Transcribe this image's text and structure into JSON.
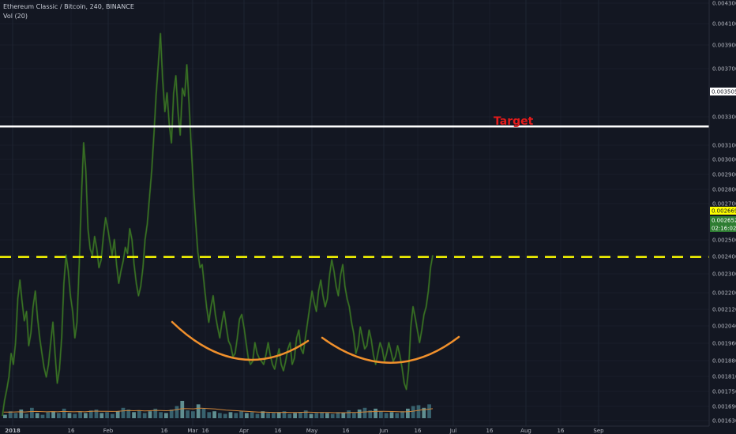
{
  "header": {
    "symbol": "Ethereum Classic / Bitcoin, 240, BINANCE",
    "volume_label": "Vol (20)"
  },
  "colors": {
    "background": "#131722",
    "grid": "#1e2433",
    "price_line": "#2f5a1f",
    "volume_bar": "#3f6f7a",
    "volume_bar_up": "#6ea4a4",
    "volume_ma": "#d0863a",
    "target_line": "#ffffff",
    "breakout_line": "#ffff00",
    "cup_arc": "#f0902c",
    "target_text": "#e31b1b"
  },
  "chart_data": {
    "type": "line",
    "price_axis": {
      "range": [
        0.0016,
        0.0043
      ],
      "tick_labels": [
        "0.004300",
        "0.004100",
        "0.003900",
        "0.003700",
        "0.003505",
        "0.003300",
        "0.003100",
        "0.003000",
        "0.002900",
        "0.002800",
        "0.002700",
        "0.002669",
        "0.002652",
        "02:16:02",
        "0.002500",
        "0.002400",
        "0.002300",
        "0.002200",
        "0.002120",
        "0.002040",
        "0.001960",
        "0.001880",
        "0.001810",
        "0.001750",
        "0.001690",
        "0.001630"
      ]
    },
    "time_axis": {
      "labels": [
        "2018",
        "16",
        "Feb",
        "16",
        "Mar",
        "16",
        "Apr",
        "16",
        "May",
        "16",
        "Jun",
        "16",
        "Jul",
        "16",
        "Aug",
        "16",
        "Sep"
      ]
    },
    "series": [
      {
        "values": [
          0.00165,
          0.00175,
          0.00182,
          0.0019,
          0.00205,
          0.00198,
          0.00212,
          0.0024,
          0.00252,
          0.00238,
          0.00226,
          0.00232,
          0.0021,
          0.00218,
          0.00235,
          0.00245,
          0.00228,
          0.00215,
          0.00205,
          0.00196,
          0.0019,
          0.00198,
          0.00212,
          0.00225,
          0.00205,
          0.00186,
          0.00195,
          0.00215,
          0.0025,
          0.00268,
          0.00258,
          0.00242,
          0.00232,
          0.00215,
          0.00225,
          0.00262,
          0.00305,
          0.0034,
          0.00322,
          0.00285,
          0.00272,
          0.00268,
          0.0028,
          0.00272,
          0.0026,
          0.00265,
          0.0028,
          0.00292,
          0.00285,
          0.00276,
          0.00268,
          0.00278,
          0.00262,
          0.0025,
          0.00258,
          0.00264,
          0.00273,
          0.00269,
          0.00285,
          0.00278,
          0.00262,
          0.0025,
          0.00242,
          0.00248,
          0.0026,
          0.00278,
          0.00288,
          0.00305,
          0.00322,
          0.00345,
          0.0037,
          0.0039,
          0.0041,
          0.0038,
          0.0036,
          0.00372,
          0.00352,
          0.0034,
          0.00372,
          0.00383,
          0.0036,
          0.00345,
          0.00375,
          0.0037,
          0.0039,
          0.00365,
          0.00338,
          0.00312,
          0.0029,
          0.0027,
          0.0026,
          0.00262,
          0.00248,
          0.00235,
          0.00225,
          0.00235,
          0.00242,
          0.0023,
          0.00222,
          0.00215,
          0.00225,
          0.00232,
          0.00222,
          0.00213,
          0.0021,
          0.00203,
          0.00205,
          0.00215,
          0.00227,
          0.0023,
          0.00222,
          0.00212,
          0.00202,
          0.00198,
          0.002,
          0.00212,
          0.00205,
          0.00202,
          0.002,
          0.00198,
          0.00204,
          0.00212,
          0.00204,
          0.00198,
          0.00195,
          0.00202,
          0.00208,
          0.00198,
          0.00194,
          0.002,
          0.00208,
          0.00212,
          0.00198,
          0.00202,
          0.00215,
          0.0022,
          0.00208,
          0.00205,
          0.00215,
          0.00225,
          0.00235,
          0.00245,
          0.00238,
          0.00232,
          0.00245,
          0.00252,
          0.00242,
          0.00235,
          0.0024,
          0.00255,
          0.00265,
          0.00258,
          0.00248,
          0.00242,
          0.00255,
          0.00262,
          0.00248,
          0.0024,
          0.00235,
          0.00225,
          0.00218,
          0.00205,
          0.0021,
          0.00222,
          0.00215,
          0.00208,
          0.0021,
          0.0022,
          0.00214,
          0.00204,
          0.00198,
          0.00205,
          0.00212,
          0.00208,
          0.002,
          0.00205,
          0.00212,
          0.00206,
          0.002,
          0.00203,
          0.0021,
          0.00204,
          0.00196,
          0.00186,
          0.00182,
          0.00195,
          0.00222,
          0.00235,
          0.00228,
          0.0022,
          0.00212,
          0.0022,
          0.0023,
          0.00235,
          0.00245,
          0.0026,
          0.00268
        ]
      }
    ],
    "annotations": {
      "target_text": "Target",
      "target_level": 0.003505,
      "breakout_level": 0.002669,
      "cup_1": {
        "from": "Mar 12",
        "to": "May 4",
        "depth_price": 0.00184
      },
      "cup_2": {
        "from": "May 5",
        "to": "Jun 28",
        "depth_price": 0.00184
      }
    },
    "volume": {
      "values": [
        0.2,
        0.4,
        0.3,
        0.5,
        0.25,
        0.6,
        0.3,
        0.2,
        0.35,
        0.4,
        0.3,
        0.55,
        0.3,
        0.25,
        0.4,
        0.3,
        0.45,
        0.5,
        0.3,
        0.35,
        0.25,
        0.4,
        0.6,
        0.5,
        0.35,
        0.45,
        0.3,
        0.4,
        0.55,
        0.35,
        0.3,
        0.5,
        0.7,
        1.0,
        0.45,
        0.4,
        0.8,
        0.55,
        0.35,
        0.4,
        0.3,
        0.25,
        0.35,
        0.3,
        0.4,
        0.3,
        0.35,
        0.25,
        0.4,
        0.3,
        0.3,
        0.35,
        0.4,
        0.25,
        0.3,
        0.35,
        0.45,
        0.25,
        0.3,
        0.35,
        0.3,
        0.25,
        0.35,
        0.3,
        0.45,
        0.3,
        0.5,
        0.6,
        0.45,
        0.55,
        0.4,
        0.3,
        0.35,
        0.3,
        0.4,
        0.55,
        0.7,
        0.75,
        0.6,
        0.8
      ],
      "ma_values": [
        0.35,
        0.35,
        0.36,
        0.37,
        0.36,
        0.38,
        0.39,
        0.38,
        0.37,
        0.38,
        0.37,
        0.39,
        0.38,
        0.37,
        0.38,
        0.37,
        0.39,
        0.41,
        0.4,
        0.4,
        0.39,
        0.4,
        0.42,
        0.44,
        0.43,
        0.44,
        0.42,
        0.43,
        0.45,
        0.44,
        0.43,
        0.45,
        0.5,
        0.56,
        0.55,
        0.54,
        0.58,
        0.57,
        0.55,
        0.53,
        0.5,
        0.47,
        0.45,
        0.43,
        0.41,
        0.39,
        0.37,
        0.35,
        0.35,
        0.34,
        0.33,
        0.33,
        0.34,
        0.33,
        0.33,
        0.34,
        0.35,
        0.34,
        0.33,
        0.33,
        0.33,
        0.32,
        0.32,
        0.32,
        0.33,
        0.33,
        0.35,
        0.37,
        0.38,
        0.4,
        0.4,
        0.39,
        0.38,
        0.37,
        0.37,
        0.39,
        0.43,
        0.48,
        0.51,
        0.55
      ]
    }
  }
}
